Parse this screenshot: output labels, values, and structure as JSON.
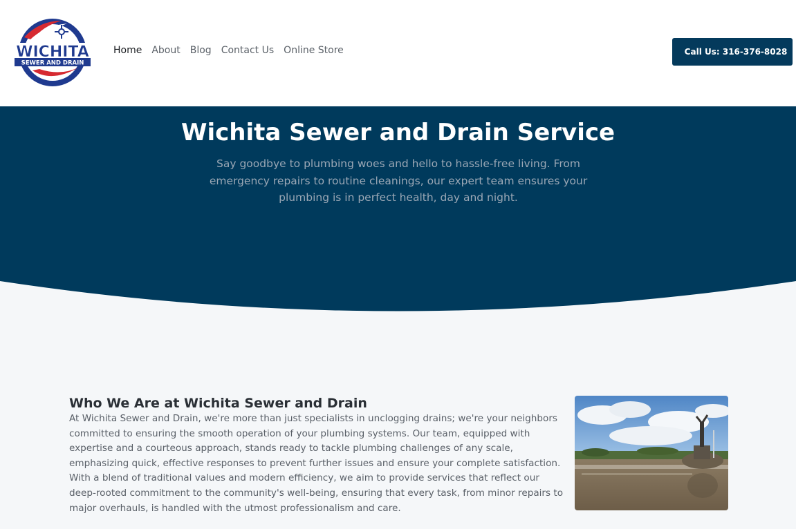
{
  "header": {
    "logo": {
      "line1": "WICHITA",
      "line2": "SEWER AND DRAIN",
      "colors": {
        "blue": "#1f3a8f",
        "red": "#d62a31"
      }
    },
    "nav": [
      {
        "label": "Home",
        "active": true
      },
      {
        "label": "About"
      },
      {
        "label": "Blog"
      },
      {
        "label": "Contact Us"
      },
      {
        "label": "Online Store"
      }
    ],
    "cta_label": "Call Us: 316-376-8028"
  },
  "hero": {
    "title": "Wichita Sewer and Drain Service",
    "subtitle": "Say goodbye to plumbing woes and hello to hassle-free living. From emergency repairs to routine cleanings, our expert team ensures your plumbing is in perfect health, day and night.",
    "background_color": "#003a5c"
  },
  "about": {
    "title": "Who We Are at Wichita Sewer and Drain",
    "body": "At Wichita Sewer and Drain, we're more than just specialists in unclogging drains; we're your neighbors committed to ensuring the smooth operation of your plumbing systems. Our team, equipped with expertise and a courteous approach, stands ready to tackle plumbing challenges of any scale, emphasizing quick, effective responses to prevent further issues and ensure your complete satisfaction. With a blend of traditional values and modern efficiency, we aim to provide services that reflect our deep-rooted commitment to the community's well-being, ensuring that every task, from minor repairs to major overhauls, is handled with the utmost professionalism and care."
  }
}
